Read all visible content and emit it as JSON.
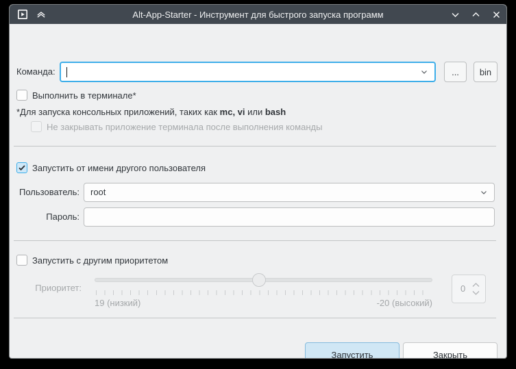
{
  "titlebar": {
    "title": "Alt-App-Starter - Инструмент для быстрого запуска программ"
  },
  "command": {
    "label": "Команда:",
    "value": "",
    "browse_button": "...",
    "bin_button": "bin"
  },
  "terminal": {
    "label": "Выполнить в терминале*",
    "checked": false,
    "note_prefix": "*Для запуска консольных приложений, таких как ",
    "note_bold1": "mc",
    "note_sep1": ", ",
    "note_bold2": "vi",
    "note_sep2": " или ",
    "note_bold3": "bash",
    "noclose_label": "Не закрывать приложение терминала после выполнения команды",
    "noclose_checked": false
  },
  "runas": {
    "label": "Запустить от имени другого пользователя",
    "checked": true,
    "user_label": "Пользователь:",
    "user_value": "root",
    "password_label": "Пароль:",
    "password_value": ""
  },
  "priority": {
    "label_checkbox": "Запустить с другим приоритетом",
    "checked": false,
    "label": "Приоритет:",
    "low_label": "19 (низкий)",
    "high_label": "-20 (высокий)",
    "slider_min": 19,
    "slider_max": -20,
    "slider_value": 0,
    "spin_value": "0"
  },
  "footer": {
    "run": "Запустить",
    "close": "Закрыть"
  },
  "colors": {
    "accent": "#3daee9",
    "titlebar_bg": "#414850",
    "body_bg": "#eff0f1",
    "run_button_bg": "#d0e7f5",
    "checked_box_bg": "#cfe8f8"
  }
}
